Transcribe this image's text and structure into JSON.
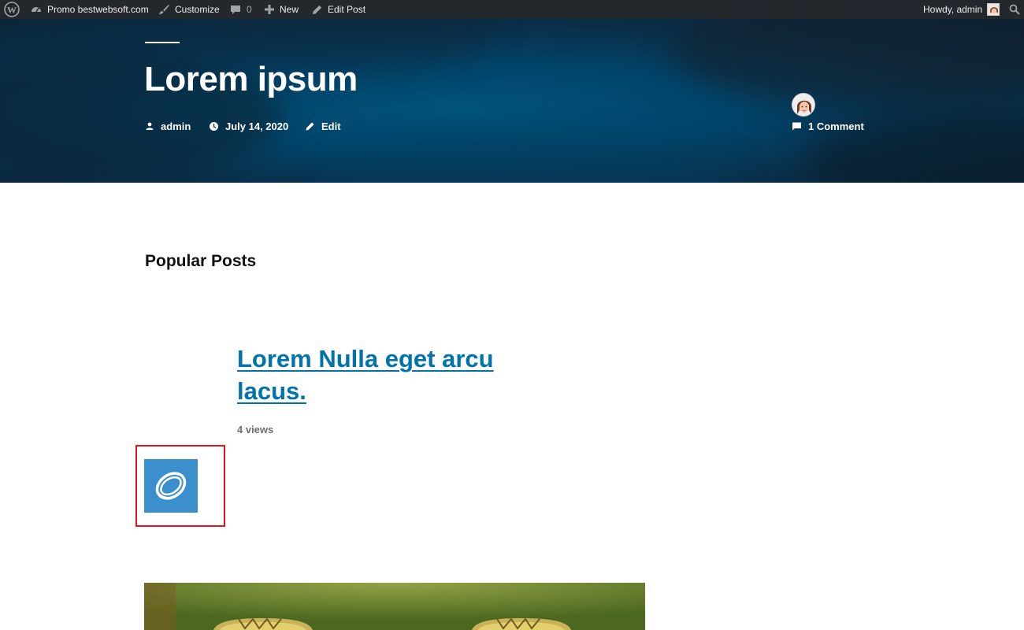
{
  "adminbar": {
    "site_name": "Promo bestwebsoft.com",
    "customize": "Customize",
    "comments_count": "0",
    "new_label": "New",
    "edit_post": "Edit Post",
    "howdy": "Howdy, admin"
  },
  "post": {
    "title": "Lorem ipsum",
    "author": "admin",
    "date": "July 14, 2020",
    "edit": "Edit",
    "comments": "1 Comment"
  },
  "popular_posts": {
    "heading": "Popular Posts",
    "items": [
      {
        "title": "Lorem Nulla eget arcu lacus.",
        "views": "4 views"
      }
    ]
  },
  "colors": {
    "adminbar_bg": "#23282d",
    "header_blue": "#01446a",
    "link": "#0073aa",
    "highlight": "#e0161b",
    "logo_tile": "#3a8fcc"
  }
}
